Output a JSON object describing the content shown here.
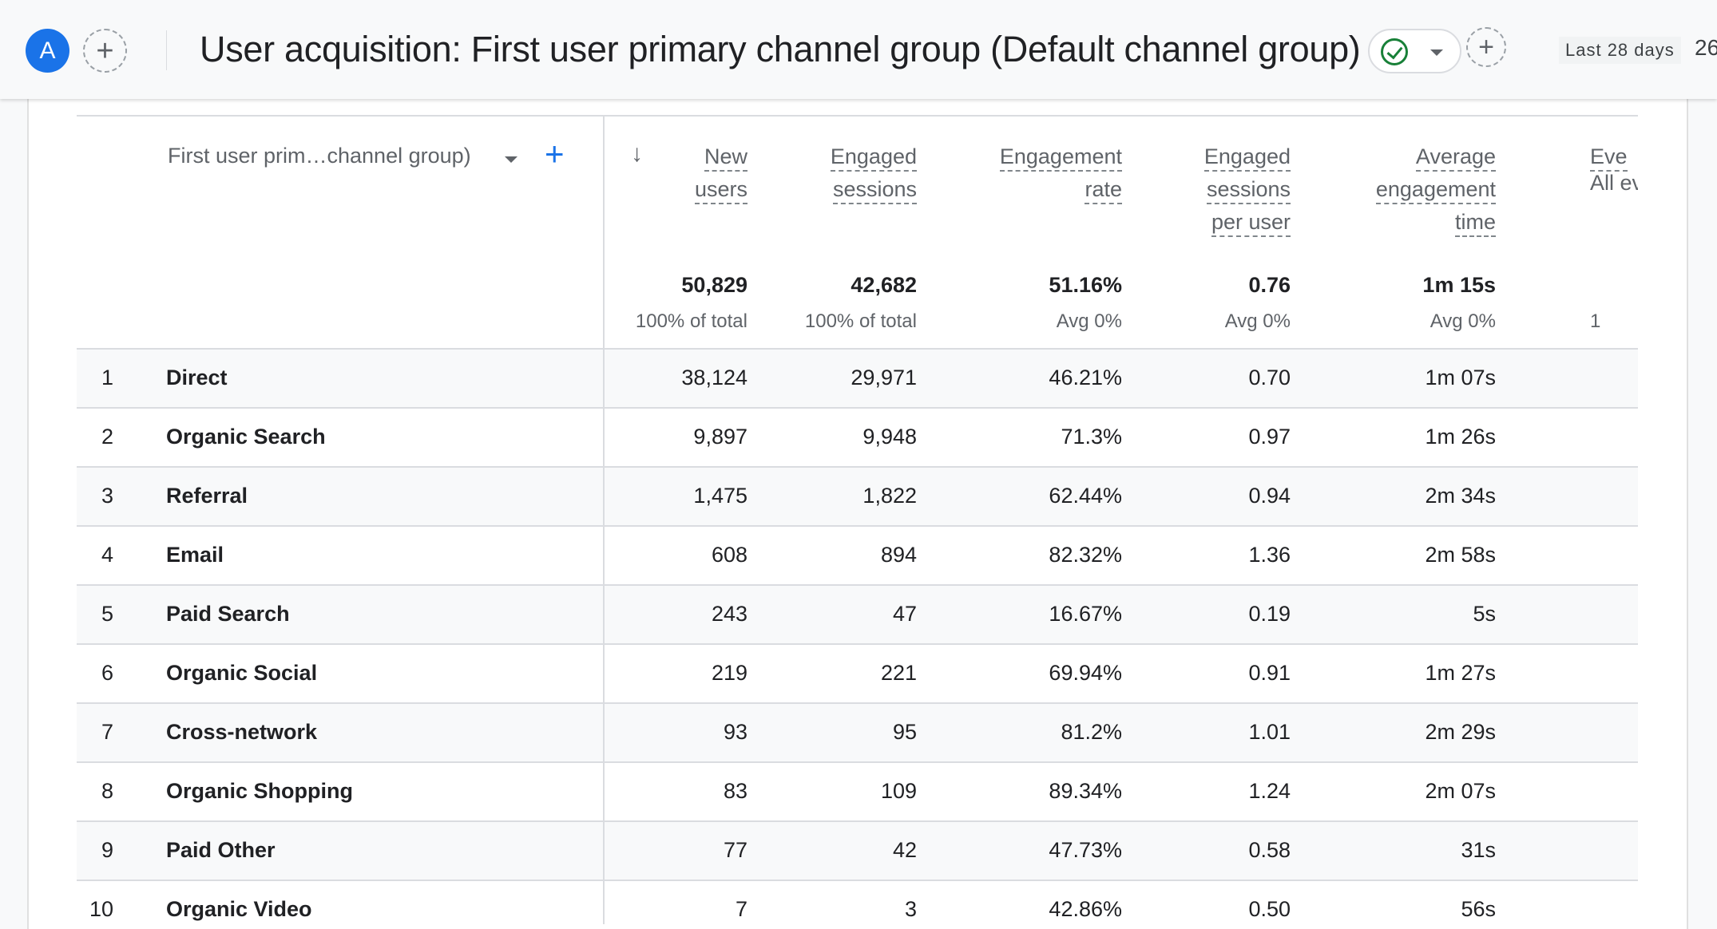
{
  "header": {
    "avatar_letter": "A",
    "title": "User acquisition: First user primary channel group (Default channel group)",
    "date_range": "Last 28 days",
    "date_partial": "26",
    "colors": {
      "accent": "#1a73e8",
      "status_ok": "#188038"
    },
    "icons": [
      "plus-icon",
      "check-circle-icon",
      "chevron-down-icon"
    ]
  },
  "table": {
    "dimension_label": "First user prim…channel group)",
    "metrics": [
      {
        "label_lines": [
          "New",
          "users"
        ],
        "total": "50,829",
        "subtotal": "100% of total"
      },
      {
        "label_lines": [
          "Engaged",
          "sessions"
        ],
        "total": "42,682",
        "subtotal": "100% of total"
      },
      {
        "label_lines": [
          "Engagement",
          "rate"
        ],
        "total": "51.16%",
        "subtotal": "Avg 0%"
      },
      {
        "label_lines": [
          "Engaged",
          "sessions",
          "per user"
        ],
        "total": "0.76",
        "subtotal": "Avg 0%"
      },
      {
        "label_lines": [
          "Average",
          "engagement",
          "time"
        ],
        "total": "1m 15s",
        "subtotal": "Avg 0%"
      },
      {
        "label_lines": [
          "Eve"
        ],
        "total": "",
        "subtotal": "1",
        "note": "All ev"
      }
    ],
    "rows": [
      {
        "rank": "1",
        "channel": "Direct",
        "values": [
          "38,124",
          "29,971",
          "46.21%",
          "0.70",
          "1m 07s"
        ]
      },
      {
        "rank": "2",
        "channel": "Organic Search",
        "values": [
          "9,897",
          "9,948",
          "71.3%",
          "0.97",
          "1m 26s"
        ]
      },
      {
        "rank": "3",
        "channel": "Referral",
        "values": [
          "1,475",
          "1,822",
          "62.44%",
          "0.94",
          "2m 34s"
        ]
      },
      {
        "rank": "4",
        "channel": "Email",
        "values": [
          "608",
          "894",
          "82.32%",
          "1.36",
          "2m 58s"
        ]
      },
      {
        "rank": "5",
        "channel": "Paid Search",
        "values": [
          "243",
          "47",
          "16.67%",
          "0.19",
          "5s"
        ]
      },
      {
        "rank": "6",
        "channel": "Organic Social",
        "values": [
          "219",
          "221",
          "69.94%",
          "0.91",
          "1m 27s"
        ]
      },
      {
        "rank": "7",
        "channel": "Cross-network",
        "values": [
          "93",
          "95",
          "81.2%",
          "1.01",
          "2m 29s"
        ]
      },
      {
        "rank": "8",
        "channel": "Organic Shopping",
        "values": [
          "83",
          "109",
          "89.34%",
          "1.24",
          "2m 07s"
        ]
      },
      {
        "rank": "9",
        "channel": "Paid Other",
        "values": [
          "77",
          "42",
          "47.73%",
          "0.58",
          "31s"
        ]
      },
      {
        "rank": "10",
        "channel": "Organic Video",
        "values": [
          "7",
          "3",
          "42.86%",
          "0.50",
          "56s"
        ]
      }
    ]
  }
}
